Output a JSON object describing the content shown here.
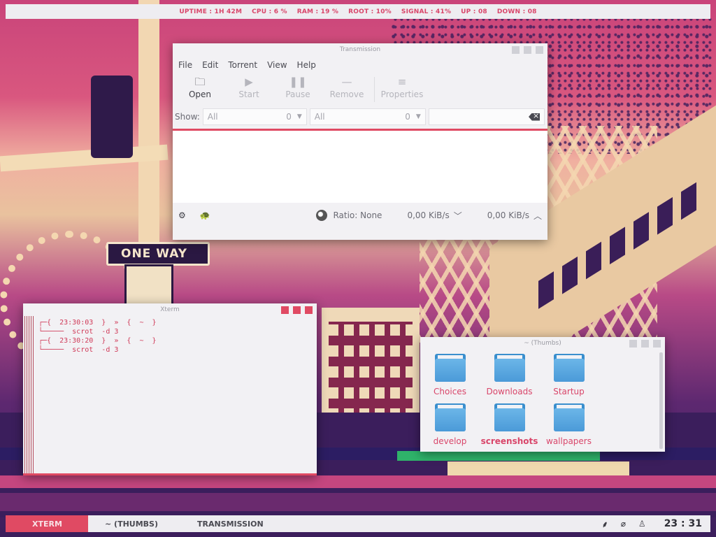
{
  "topbar": {
    "uptime": "UPTIME : 1H 42M",
    "cpu": "CPU : 6 %",
    "ram": "RAM : 19 %",
    "root": "ROOT : 10%",
    "signal": "SIGNAL : 41%",
    "up": "UP : 08",
    "down": "DOWN : 08"
  },
  "wallpaper": {
    "sign_text": "ONE  WAY"
  },
  "transmission": {
    "title": "Transmission",
    "menu": [
      "File",
      "Edit",
      "Torrent",
      "View",
      "Help"
    ],
    "toolbar": {
      "open": "Open",
      "start": "Start",
      "pause": "Pause",
      "remove": "Remove",
      "properties": "Properties"
    },
    "filter": {
      "show_label": "Show:",
      "combo1_value": "All",
      "combo1_count": "0",
      "combo2_value": "All",
      "combo2_count": "0"
    },
    "status": {
      "ratio": "Ratio: None",
      "down_speed": "0,00 KiB/s",
      "up_speed": "0,00 KiB/s"
    }
  },
  "xterm": {
    "title": "Xterm",
    "lines": [
      "┌─{  23:30:03  }  »  {  ~  }",
      "└─────  scrot  -d 3",
      "┌─{  23:30:20  }  »  {  ~  }",
      "└─────  scrot  -d 3"
    ]
  },
  "thumbs": {
    "title": "~ (Thumbs)",
    "folders": [
      "Choices",
      "Downloads",
      "Startup",
      "develop",
      "screenshots",
      "wallpapers"
    ]
  },
  "taskbar": {
    "tasks": [
      "XTERM",
      "~ (THUMBS)",
      "TRANSMISSION"
    ],
    "clock": "23 : 31"
  },
  "colors": {
    "accent": "#e04a63",
    "text_accent": "#d9466a",
    "bar_bg": "#eeedf1"
  }
}
